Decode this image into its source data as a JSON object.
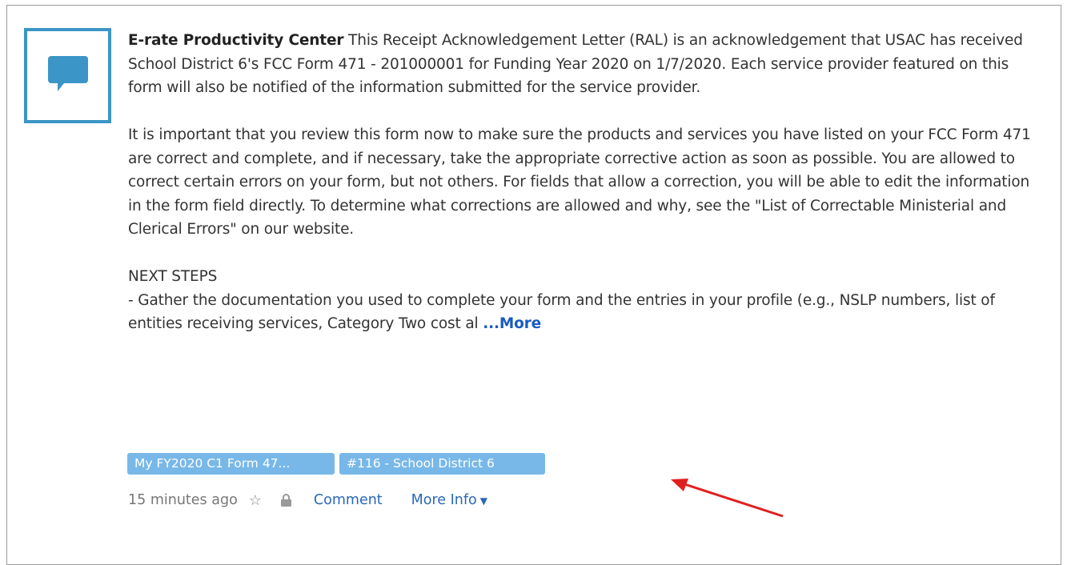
{
  "post": {
    "author": "E-rate Productivity Center",
    "paragraph1_text": " This Receipt Acknowledgement Letter (RAL) is an acknowledgement that USAC has received School District 6's FCC Form 471 - 201000001 for Funding Year 2020 on 1/7/2020.  Each service provider featured on this form will also be notified of the information submitted for the service provider.",
    "paragraph2_text": "It is important that you review this form now to make sure the products and services you have listed on your FCC Form 471 are correct and complete, and if necessary, take the appropriate corrective action as soon as possible.  You are allowed to correct certain errors on your form, but not others.  For fields that allow a correction, you will be able to edit the information in the form field directly.  To determine what corrections are allowed and why, see the \"List of Correctable Ministerial and Clerical Errors\" on our website.",
    "next_steps_heading": "NEXT STEPS",
    "next_steps_text": "- Gather the documentation you used to complete your form and the entries in your profile (e.g., NSLP numbers, list of entities receiving services, Category Two cost al ",
    "more_label": "...More"
  },
  "tags": [
    {
      "label": "My FY2020 C1 Form 47..."
    },
    {
      "label": "#116 - School District 6"
    }
  ],
  "meta": {
    "timestamp": "15 minutes ago",
    "comment_label": "Comment",
    "more_info_label": "More Info"
  },
  "icons": {
    "avatar": "chat-bubble-icon",
    "star": "star-outline-icon",
    "lock": "lock-icon",
    "caret": "caret-down-icon"
  },
  "colors": {
    "accent": "#3b95c6",
    "tag_bg": "#78b8e8",
    "link": "#2a68b8",
    "arrow": "#e02020"
  }
}
